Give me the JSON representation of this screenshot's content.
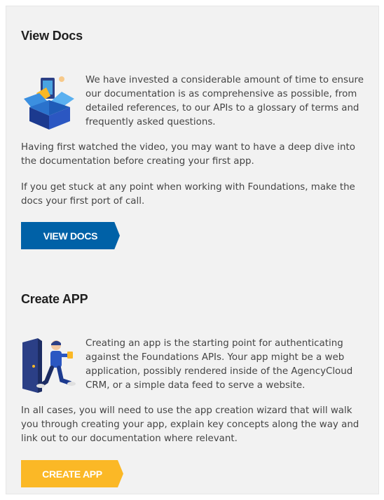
{
  "view_docs": {
    "title": "View Docs",
    "intro": "We have invested a considerable amount of time to ensure our documentation is as comprehensive as possible, from detailed references, to our APIs to a glossary of terms and frequently asked questions.",
    "para1": "Having first watched the video, you may want to have a deep dive into the documentation before creating your first app.",
    "para2": "If you get stuck at any point when working with Foundations, make the docs your first port of call.",
    "button_label": "VIEW DOCS",
    "illustration_icon": "open-box-icon"
  },
  "create_app": {
    "title": "Create APP",
    "intro": "Creating an app is the starting point for authenticating against the Foundations APIs. Your app might be a web application, possibly rendered inside of the AgencyCloud CRM, or a simple data feed to serve a website.",
    "para1": "In all cases, you will need to use the app creation wizard that will walk you through creating your app, explain key concepts along the way and link out to our documentation where relevant.",
    "button_label": "CREATE APP",
    "illustration_icon": "person-door-icon"
  },
  "colors": {
    "primary_blue": "#0061a7",
    "accent_yellow": "#fbb826",
    "panel_bg": "#f2f2f2"
  }
}
